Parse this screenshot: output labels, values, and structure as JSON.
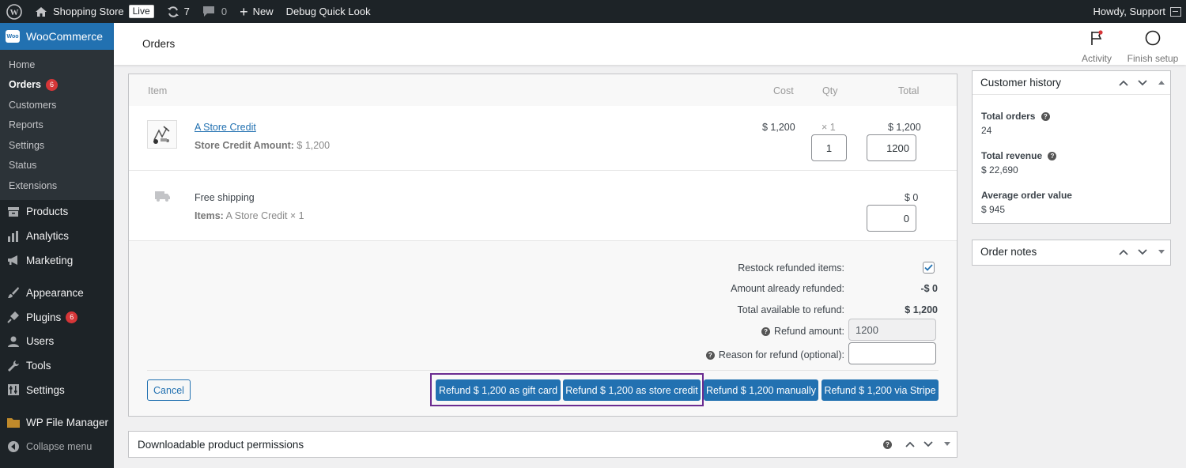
{
  "adminbar": {
    "site_name": "Shopping Store",
    "live_badge": "Live",
    "updates_count": "7",
    "comments_count": "0",
    "new_label": "New",
    "debug_label": "Debug Quick Look",
    "howdy": "Howdy, Support"
  },
  "sidebar": {
    "woocommerce": "WooCommerce",
    "sub_items": [
      {
        "label": "Home"
      },
      {
        "label": "Orders",
        "badge": "6"
      },
      {
        "label": "Customers"
      },
      {
        "label": "Reports"
      },
      {
        "label": "Settings"
      },
      {
        "label": "Status"
      },
      {
        "label": "Extensions"
      }
    ],
    "products": "Products",
    "analytics": "Analytics",
    "marketing": "Marketing",
    "appearance": "Appearance",
    "plugins": "Plugins",
    "plugins_badge": "6",
    "users": "Users",
    "tools": "Tools",
    "settings": "Settings",
    "file_manager": "WP File Manager",
    "collapse": "Collapse menu"
  },
  "header": {
    "title": "Orders",
    "activity": "Activity",
    "finish_setup": "Finish setup"
  },
  "items_table": {
    "col_item": "Item",
    "col_cost": "Cost",
    "col_qty": "Qty",
    "col_total": "Total",
    "line_item": {
      "name": "A Store Credit",
      "meta_label": "Store Credit Amount:",
      "meta_value": "$ 1,200",
      "cost": "$ 1,200",
      "qty_display": "× 1",
      "total": "$ 1,200",
      "qty_input": "1",
      "total_input": "1200"
    },
    "shipping": {
      "name": "Free shipping",
      "meta_label": "Items:",
      "meta_value": "A Store Credit × 1",
      "total": "$ 0",
      "total_input": "0"
    }
  },
  "refund": {
    "restock_label": "Restock refunded items:",
    "already_label": "Amount already refunded:",
    "already_value": "-$ 0",
    "available_label": "Total available to refund:",
    "available_value": "$ 1,200",
    "amount_label": "Refund amount:",
    "amount_value": "1200",
    "reason_label": "Reason for refund (optional):",
    "reason_value": "",
    "cancel": "Cancel",
    "btn_gift_card": "Refund $ 1,200 as gift card",
    "btn_store_credit": "Refund $ 1,200 as store credit",
    "btn_manual": "Refund $ 1,200 manually",
    "btn_stripe": "Refund $ 1,200 via Stripe"
  },
  "downloads": {
    "title": "Downloadable product permissions"
  },
  "customer_history": {
    "title": "Customer history",
    "total_orders_label": "Total orders",
    "total_orders": "24",
    "total_revenue_label": "Total revenue",
    "total_revenue": "$ 22,690",
    "avg_label": "Average order value",
    "avg_value": "$ 945"
  },
  "order_notes": {
    "title": "Order notes"
  },
  "colors": {
    "admin_dark": "#1d2327",
    "wp_blue": "#2271b1",
    "badge_red": "#d63638",
    "highlight_purple": "#6b2c91"
  }
}
